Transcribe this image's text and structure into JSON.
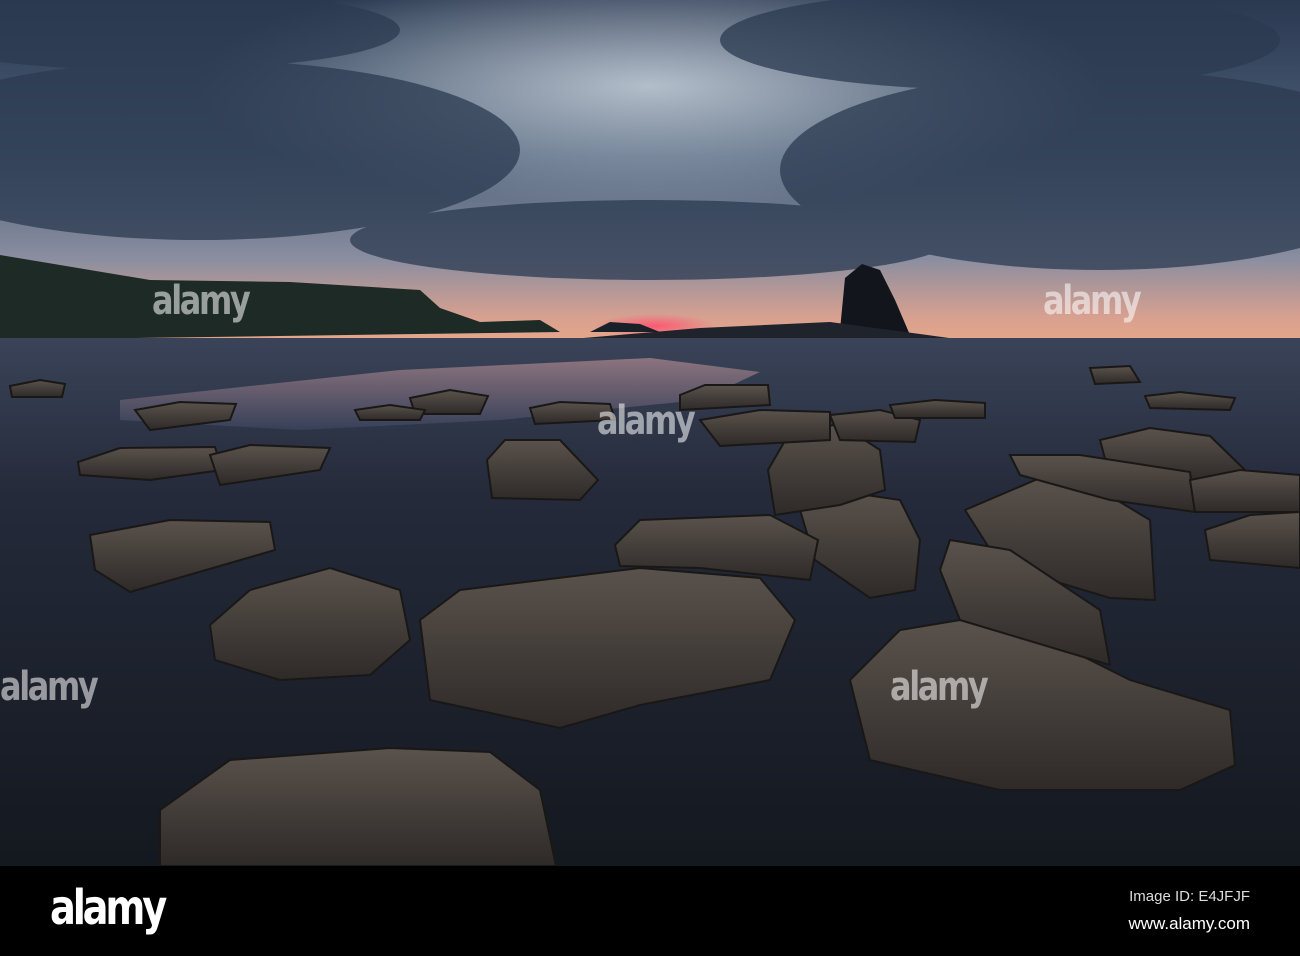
{
  "watermark": "alamy",
  "footer": {
    "logo": "alamy",
    "image_id": "Image ID: E4JFJF",
    "website": "www.alamy.com"
  },
  "colors": {
    "sky_top": "#26344a",
    "sky_light": "#a8b6c4",
    "horizon": "#e0a088",
    "sun_glow": "#e8506a",
    "ground": "#1a202c",
    "rock": "#4a4440"
  }
}
